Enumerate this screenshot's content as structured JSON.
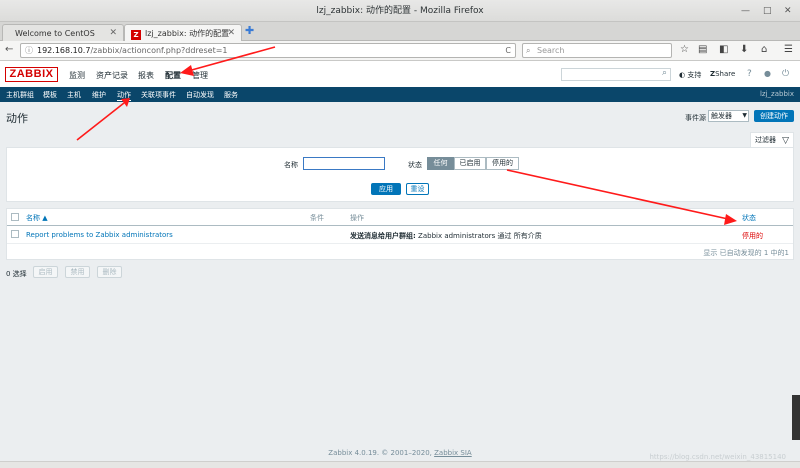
{
  "window": {
    "title": "lzj_zabbix: 动作的配置 - Mozilla Firefox",
    "ctl_min": "—",
    "ctl_max": "□",
    "ctl_close": "✕"
  },
  "tabs": [
    {
      "label": "Welcome to CentOS",
      "close": "✕"
    },
    {
      "label": "lzj_zabbix: 动作的配置",
      "close": "✕",
      "favicon": "Z"
    }
  ],
  "new_tab": "✚",
  "nav": {
    "back": "←",
    "url_host": "192.168.10.7",
    "url_path": "/zabbix/actionconf.php?ddreset=1",
    "info_icon": "ⓘ",
    "reload": "C",
    "search_placeholder": "Search",
    "toolbar_icons": [
      "☆",
      "▤",
      "◧",
      "⬇",
      "⌂",
      "☰"
    ]
  },
  "zabbix": {
    "logo": "ZABBIX",
    "top_menu": [
      "监测",
      "资产记录",
      "报表",
      "配置",
      "管理"
    ],
    "support": "支持",
    "share": "Share",
    "help": "?",
    "user_icon": "👤",
    "logout_icon": "⏻",
    "sub_menu": [
      "主机群组",
      "模板",
      "主机",
      "维护",
      "动作",
      "关联项事件",
      "自动发现",
      "服务"
    ],
    "sub_user": "lzj_zabbix"
  },
  "page": {
    "title": "动作",
    "event_source_label": "事件源",
    "event_source_value": "触发器",
    "create_button": "创建动作"
  },
  "filter": {
    "tab_label": "过滤器",
    "name_label": "名称",
    "name_value": "",
    "status_label": "状态",
    "status_options": [
      "任何",
      "已启用",
      "停用的"
    ],
    "apply": "应用",
    "reset": "重设"
  },
  "table": {
    "headers": {
      "name": "名称 ▲",
      "conditions": "条件",
      "operations": "操作",
      "status": "状态"
    },
    "rows": [
      {
        "name": "Report problems to Zabbix administrators",
        "conditions": "",
        "operation_bold": "发送消息给用户群组:",
        "operation_rest": " Zabbix administrators 通过 所有介质",
        "status": "停用的"
      }
    ],
    "footer": "显示 已自动发现的 1 中的1"
  },
  "bulk": {
    "selected": "0 选择",
    "buttons": [
      "启用",
      "禁用",
      "删除"
    ]
  },
  "footer": {
    "text": "Zabbix 4.0.19. © 2001–2020, ",
    "link": "Zabbix SIA"
  },
  "watermark": "https://blog.csdn.net/weixin_43815140",
  "colors": {
    "brand_red": "#d40000",
    "primary_blue": "#0275b8",
    "nav_dark": "#0a466a",
    "annotation_arrow": "#ff1a1a",
    "disabled_red": "#dc0000"
  }
}
